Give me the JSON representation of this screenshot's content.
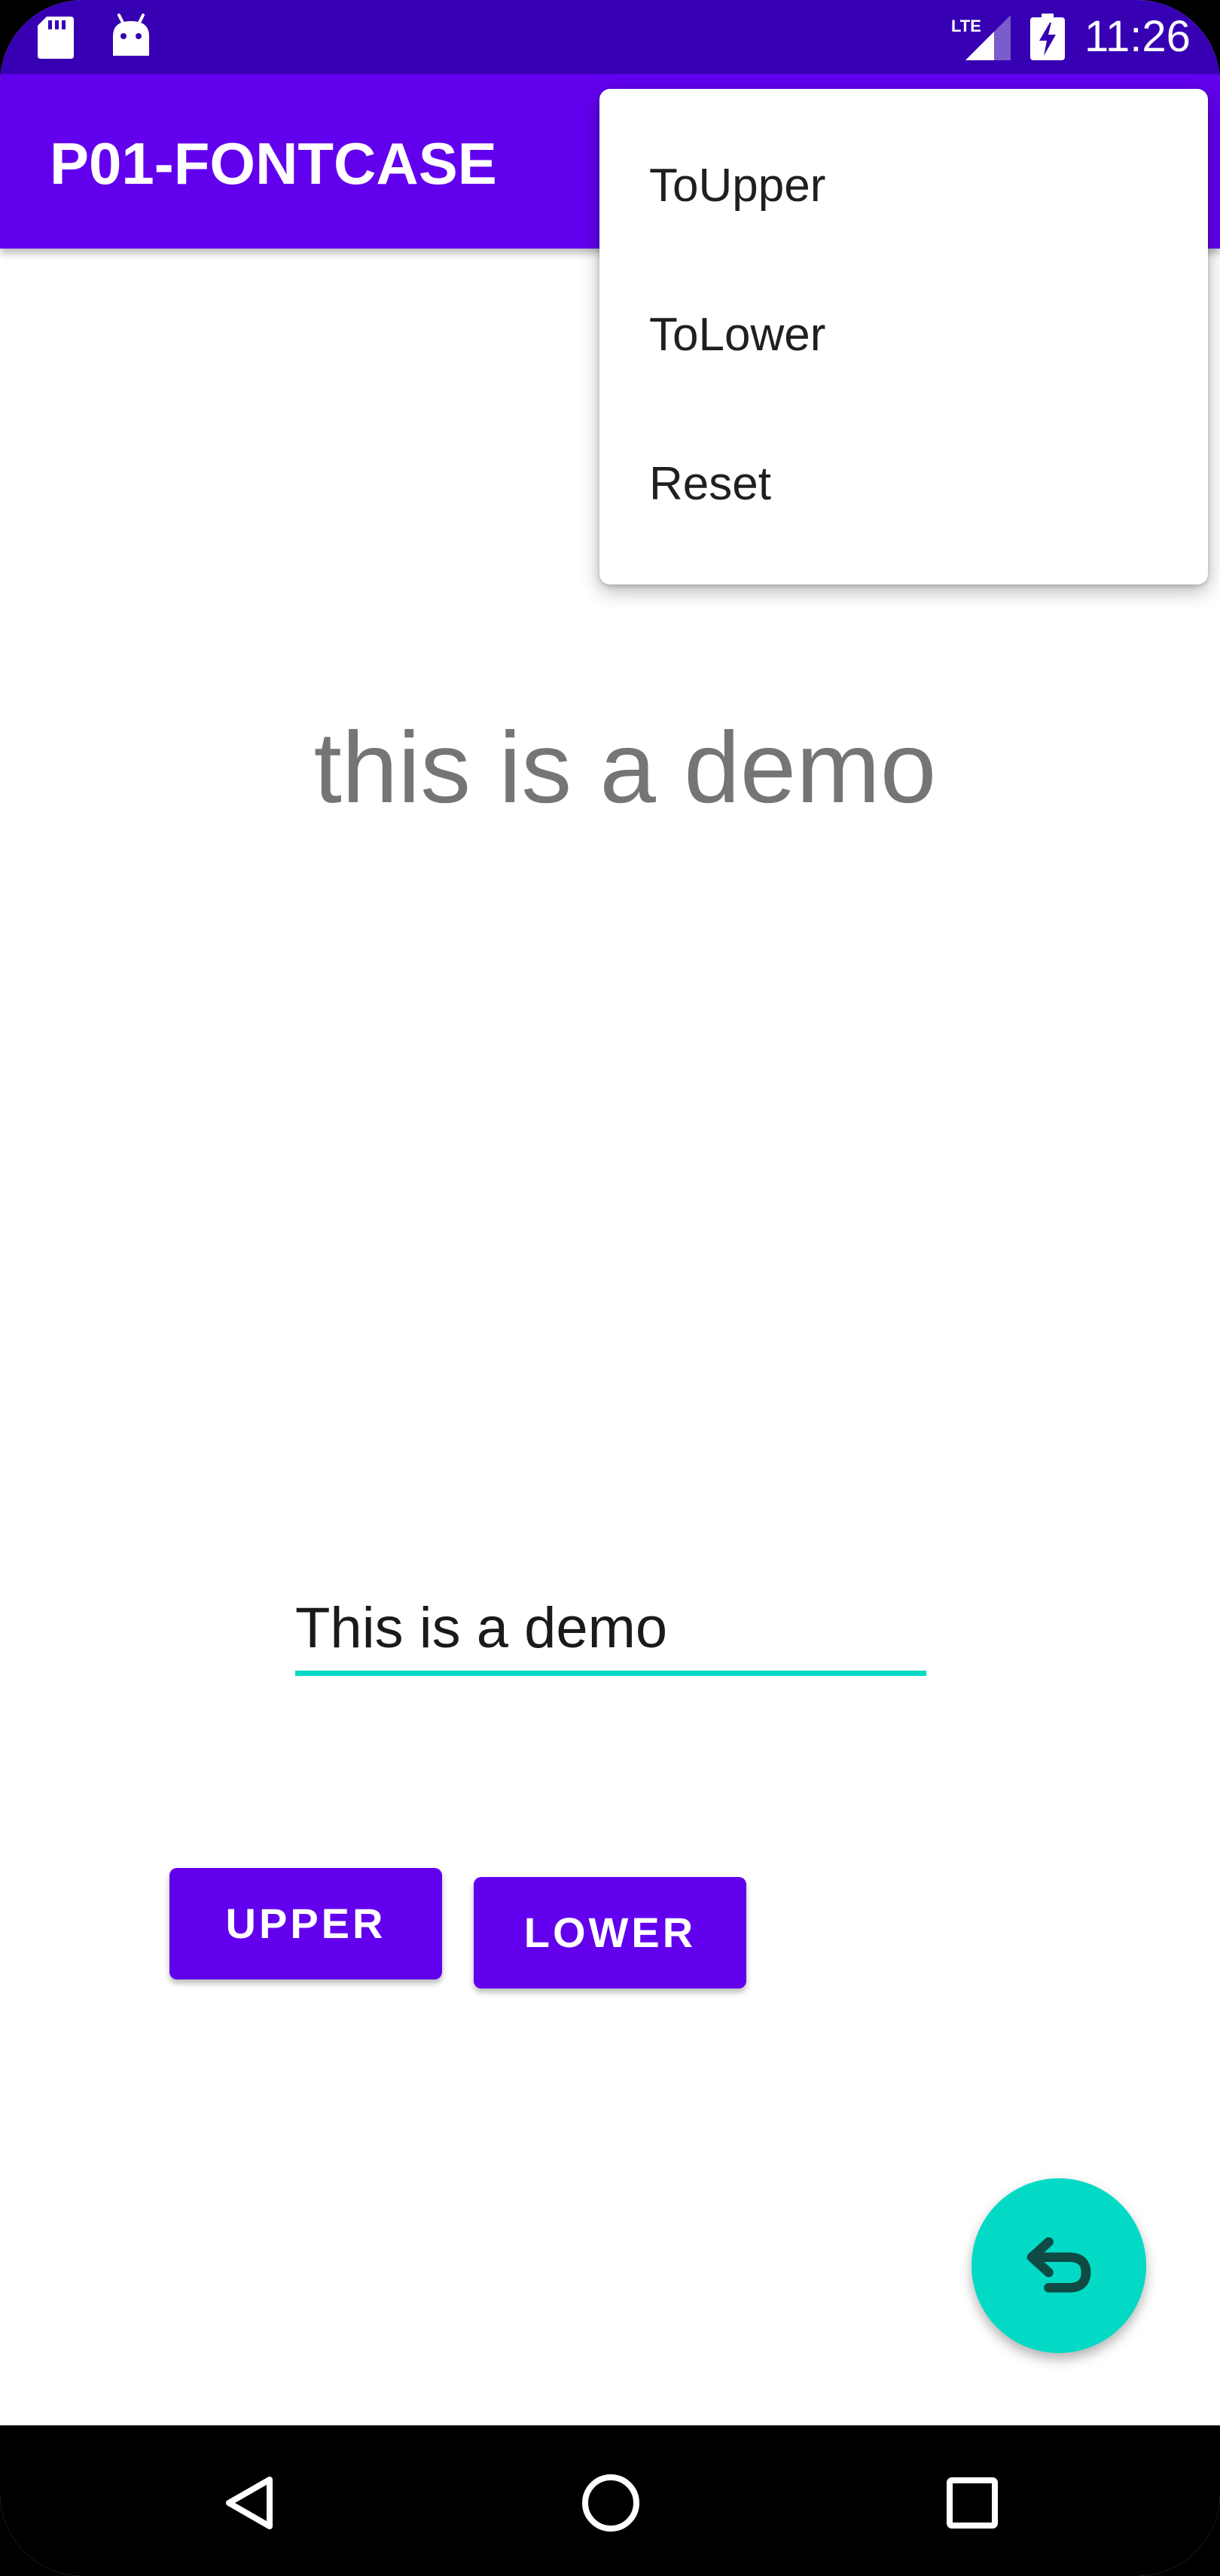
{
  "status_bar": {
    "time": "11:26",
    "network": "LTE",
    "icons": [
      "sd-card-icon",
      "android-icon",
      "lte-signal-icon",
      "battery-charging-icon"
    ]
  },
  "app_bar": {
    "title": "P01-FONTCASE"
  },
  "overflow_menu": {
    "items": [
      {
        "label": "ToUpper"
      },
      {
        "label": "ToLower"
      },
      {
        "label": "Reset"
      }
    ]
  },
  "main": {
    "display_text": "this is a demo",
    "input_value": "This is a demo",
    "upper_button_label": "UPPER",
    "lower_button_label": "LOWER",
    "fab_icon": "undo-icon"
  },
  "nav_bar": {
    "icons": [
      "back-icon",
      "home-icon",
      "recents-icon"
    ]
  },
  "colors": {
    "primary": "#6200EE",
    "primary_dark": "#3700B3",
    "accent": "#03DAC5"
  }
}
